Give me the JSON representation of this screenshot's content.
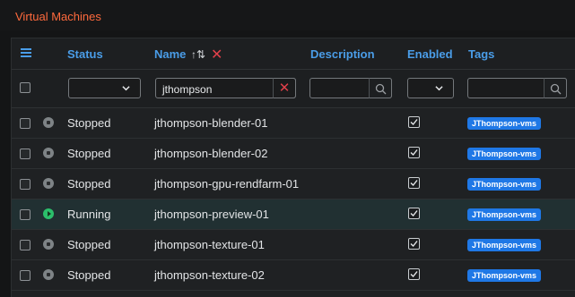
{
  "page": {
    "title": "Virtual Machines"
  },
  "columns": {
    "status": "Status",
    "name": "Name",
    "description": "Description",
    "enabled": "Enabled",
    "tags": "Tags"
  },
  "filters": {
    "status_value": "",
    "name_value": "jthompson",
    "description_value": "",
    "enabled_value": "",
    "tags_value": ""
  },
  "icons": {
    "menu": "hamburger-menu-icon",
    "sort": "sort-ascending-icon",
    "clear_sort": "close-icon",
    "clear_filter": "close-icon",
    "search": "search-icon",
    "dropdown": "chevron-down-icon",
    "stopped": "stop-circle-icon",
    "running": "play-circle-icon",
    "checked": "checkbox-checked-icon"
  },
  "colors": {
    "title": "#ff6a3d",
    "header": "#4a9de8",
    "tag": "#1f78e6",
    "running": "#2bbf6b",
    "danger": "#e0404a"
  },
  "rows": [
    {
      "status": "Stopped",
      "name": "jthompson-blender-01",
      "enabled": true,
      "tag": "JThompson-vms"
    },
    {
      "status": "Stopped",
      "name": "jthompson-blender-02",
      "enabled": true,
      "tag": "JThompson-vms"
    },
    {
      "status": "Stopped",
      "name": "jthompson-gpu-rendfarm-01",
      "enabled": true,
      "tag": "JThompson-vms"
    },
    {
      "status": "Running",
      "name": "jthompson-preview-01",
      "enabled": true,
      "tag": "JThompson-vms"
    },
    {
      "status": "Stopped",
      "name": "jthompson-texture-01",
      "enabled": true,
      "tag": "JThompson-vms"
    },
    {
      "status": "Stopped",
      "name": "jthompson-texture-02",
      "enabled": true,
      "tag": "JThompson-vms"
    }
  ]
}
